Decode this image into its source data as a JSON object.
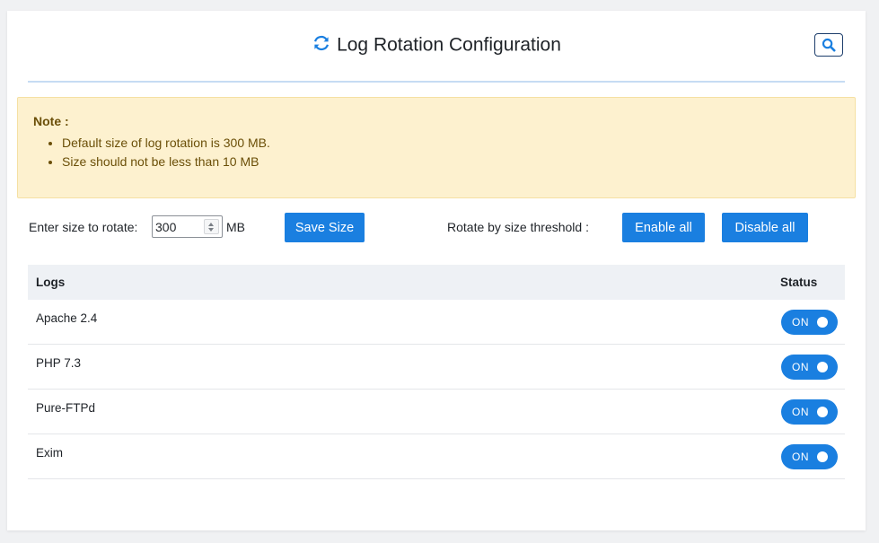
{
  "header": {
    "title": "Log Rotation Configuration",
    "title_icon": "refresh-icon",
    "search_icon": "search-icon"
  },
  "note": {
    "title": "Note :",
    "items": [
      "Default size of log rotation is 300 MB.",
      "Size should not be less than 10 MB"
    ]
  },
  "controls": {
    "size_label": "Enter size to rotate:",
    "size_value": "300",
    "unit": "MB",
    "save_label": "Save Size",
    "threshold_label": "Rotate by size threshold :",
    "enable_all_label": "Enable all",
    "disable_all_label": "Disable all"
  },
  "table": {
    "columns": [
      "Logs",
      "Status"
    ],
    "rows": [
      {
        "name": "Apache 2.4",
        "status": "ON"
      },
      {
        "name": "PHP 7.3",
        "status": "ON"
      },
      {
        "name": "Pure-FTPd",
        "status": "ON"
      },
      {
        "name": "Exim",
        "status": "ON"
      }
    ]
  },
  "colors": {
    "accent": "#1a7fe0",
    "note_bg": "#fdf1cf",
    "note_text": "#6b4f08",
    "table_header_bg": "#eef1f5"
  }
}
